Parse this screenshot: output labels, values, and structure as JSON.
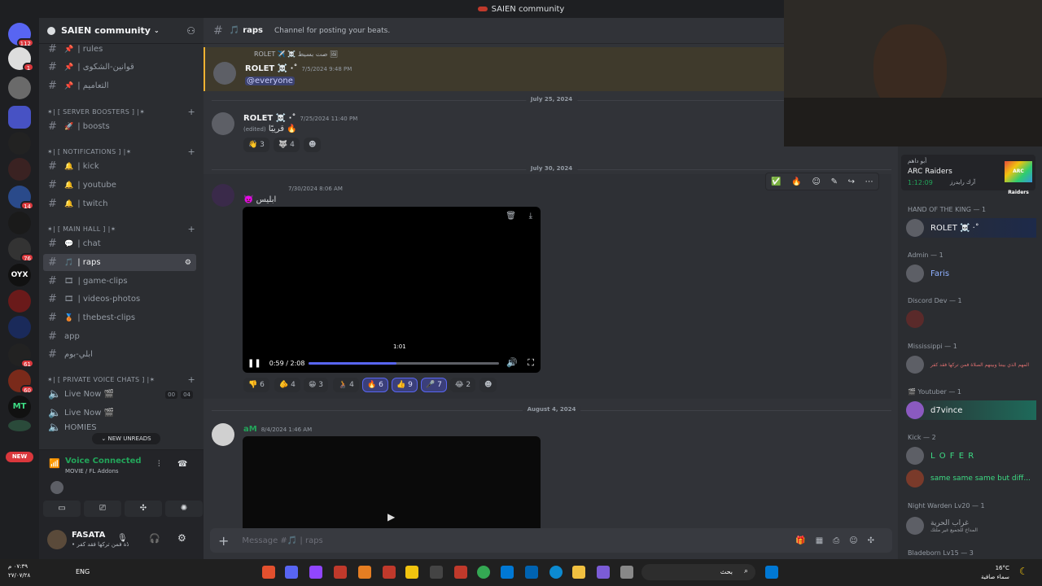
{
  "window": {
    "title": "SAIEN community"
  },
  "servers": {
    "badges": [
      "112",
      "1",
      "14",
      "76",
      "61",
      "60"
    ],
    "new_label": "NEW",
    "oyx_label": "OYX",
    "mt_label": "MT"
  },
  "sidebar": {
    "server_name": "SAIEN community",
    "channels_top": [
      {
        "icon": "📌",
        "label": "| rules"
      },
      {
        "icon": "📌",
        "label": "| قوانين-الشكوى"
      },
      {
        "icon": "📌",
        "label": "| التعاميم"
      }
    ],
    "cat_boosters": "✶| [ SERVER BOOSTERS ] |✶",
    "boosts": {
      "icon": "🚀",
      "label": "| boosts"
    },
    "cat_notifications": "✶| [ NOTIFICATIONS ] |✶",
    "notif_channels": [
      {
        "icon": "🔔",
        "label": "| kick"
      },
      {
        "icon": "🔔",
        "label": "| youtube"
      },
      {
        "icon": "🔔",
        "label": "| twitch"
      }
    ],
    "cat_mainhall": "✶| [ MAIN HALL ] |✶",
    "main_channels": [
      {
        "icon": "💬",
        "label": "| chat"
      },
      {
        "icon": "🎵",
        "label": "| raps"
      },
      {
        "icon": "🎞",
        "label": "| game-clips"
      },
      {
        "icon": "🎞",
        "label": "| videos-photos"
      },
      {
        "icon": "🥉",
        "label": "| thebest-clips"
      },
      {
        "icon": "",
        "label": "app"
      },
      {
        "icon": "",
        "label": "ابلي-بوم"
      }
    ],
    "cat_private": "✶| [ PRIVATE VOICE CHATS ] |✶",
    "voice_channels": [
      {
        "label": "Live Now 🎬",
        "counts": [
          "00",
          "04"
        ]
      },
      {
        "label": "Live Now 🎬"
      },
      {
        "label": "HOMIES"
      }
    ],
    "new_unreads": "NEW UNREADS",
    "voice_connected": "Voice Connected",
    "voice_sub": "MOVIE / FL Addons",
    "user": {
      "name": "FASATA",
      "status": "• المهم الذي بيننا وبينهم الصلاة فمن تركها فقد كفر"
    }
  },
  "channel": {
    "name": "raps",
    "icon": "🎵",
    "topic": "Channel for posting your beats."
  },
  "messages": [
    {
      "reply": "ROLET ✈️ ☠️ صت بسيط 🖼",
      "author": "ROLET ☠️ ·˚",
      "time": "7/5/2024 9:48 PM",
      "text": "@everyone"
    },
    {
      "date": "July 25, 2024"
    },
    {
      "author": "ROLET ☠️ ·˚",
      "time": "7/25/2024 11:40 PM",
      "edited": "(edited)",
      "text": "قريبًا 🔥",
      "reactions": [
        {
          "e": "👋",
          "n": "3"
        },
        {
          "e": "🐺",
          "n": "4"
        },
        {
          "e": "☻",
          "n": ""
        }
      ]
    },
    {
      "date": "July 30, 2024"
    },
    {
      "author": "",
      "time": "7/30/2024 8:06 AM",
      "text": "👿 ابليس",
      "video": {
        "time": "0:59 / 2:08",
        "hover": "1:01",
        "progress": 0.46
      },
      "reactions": [
        {
          "e": "👎",
          "n": "6"
        },
        {
          "e": "🫵",
          "n": "4"
        },
        {
          "e": "😁",
          "n": "3"
        },
        {
          "e": "🧑‍🦽",
          "n": "4"
        },
        {
          "e": "🔥",
          "n": "6",
          "on": true
        },
        {
          "e": "👍",
          "n": "9",
          "on": true
        },
        {
          "e": "🎤",
          "n": "7",
          "on": true
        },
        {
          "e": "😂",
          "n": "2"
        },
        {
          "e": "☻",
          "n": ""
        }
      ]
    },
    {
      "date": "August 4, 2024"
    },
    {
      "author": "aM",
      "time": "8/4/2024 1:46 AM"
    }
  ],
  "composer": {
    "placeholder": "Message #🎵 | raps"
  },
  "members": {
    "activity": {
      "game": "ARC Raiders",
      "sub": "أبو داهم",
      "time": "1:12:09",
      "note": "آرك رايدرز",
      "logo": "ARC Raiders"
    },
    "groups": [
      {
        "cat": "HAND OF THE KING — 1",
        "members": [
          "ROLET ☠️ ·˚"
        ]
      },
      {
        "cat": "Admin — 1",
        "members": [
          "Faris"
        ]
      },
      {
        "cat": "Discord Dev — 1",
        "members": [
          ""
        ]
      },
      {
        "cat": "Mississippi — 1",
        "members": [
          "المهم الذي بيننا وبينهم الصلاة فمن تركها فقد كفر"
        ]
      },
      {
        "cat": "🎬 Youtuber — 1",
        "members": [
          "d7vince"
        ]
      },
      {
        "cat": "Kick — 2",
        "members": [
          "L O F E R",
          "same same same but diff..."
        ]
      },
      {
        "cat": "Night Warden Lv20 — 1",
        "members": [
          "غراب الحرية"
        ],
        "sub": "المداخ للجميع غير ملتك"
      },
      {
        "cat": "Bladeborn Lv15 — 3",
        "members": []
      }
    ]
  },
  "taskbar": {
    "time": "٠٧:٣٩ م",
    "date": "٢٧/٠٧/٢٨",
    "lang": "ENG",
    "search": "بحث",
    "weather": "16°C",
    "weather_sub": "سماء صافية"
  }
}
